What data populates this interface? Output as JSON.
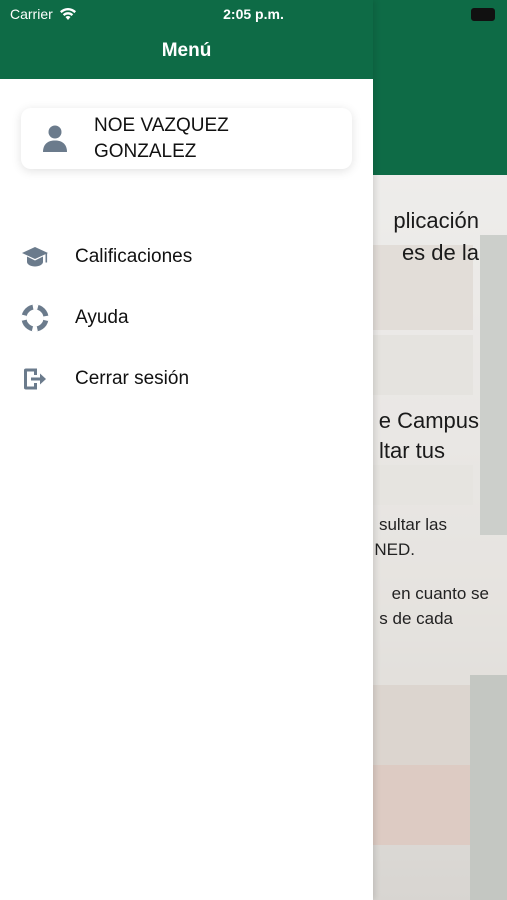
{
  "status_bar": {
    "carrier": "Carrier",
    "time": "2:05 p.m."
  },
  "drawer": {
    "title": "Menú",
    "user": {
      "name": "NOE VAZQUEZ GONZALEZ"
    },
    "menu": [
      {
        "label": "Calificaciones",
        "icon": "graduation-cap-icon"
      },
      {
        "label": "Ayuda",
        "icon": "life-ring-icon"
      },
      {
        "label": "Cerrar sesión",
        "icon": "sign-out-icon"
      }
    ]
  },
  "background": {
    "heading_line1": "plicación",
    "heading_line2": "es de la",
    "heading2_line1": "e Campus",
    "heading2_line2": "ltar tus",
    "para1_line1": "sultar las",
    "para1_line2": "NED.",
    "para2_line1": "en cuanto se",
    "para2_line2": "s de cada"
  },
  "colors": {
    "primary_green": "#0e6b46",
    "icon_gray": "#6b7b8c"
  }
}
